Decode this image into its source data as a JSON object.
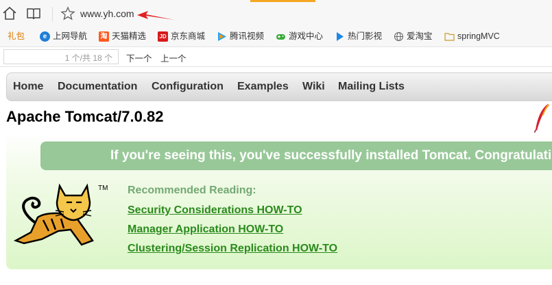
{
  "browser": {
    "url": "www.yh.com",
    "icons": [
      "home-icon",
      "reader-icon",
      "star-icon"
    ],
    "accent_color": "#f5a623"
  },
  "bookmarks": [
    {
      "label": "礼包",
      "icon": ""
    },
    {
      "label": "上网导航",
      "icon": "e"
    },
    {
      "label": "天猫精选",
      "icon": "淘"
    },
    {
      "label": "京东商城",
      "icon": "JD"
    },
    {
      "label": "腾讯视频",
      "icon": "▶"
    },
    {
      "label": "游戏中心",
      "icon": "gamepad"
    },
    {
      "label": "热门影视",
      "icon": "play"
    },
    {
      "label": "爱淘宝",
      "icon": "globe"
    },
    {
      "label": "springMVC",
      "icon": "folder"
    }
  ],
  "findbar": {
    "count": "1 个/共 18 个",
    "next": "下一个",
    "prev": "上一个"
  },
  "nav": [
    "Home",
    "Documentation",
    "Configuration",
    "Examples",
    "Wiki",
    "Mailing Lists"
  ],
  "page": {
    "title": "Apache Tomcat/7.0.82",
    "banner": "If you're seeing this, you've successfully installed Tomcat. Congratulations!",
    "trademark": "TM",
    "recommended_title": "Recommended Reading:",
    "links": [
      "Security Considerations HOW-TO",
      "Manager Application HOW-TO",
      "Clustering/Session Replication HOW-TO"
    ]
  },
  "colors": {
    "banner_bg": "#98c898",
    "link": "#2a8a1c",
    "recommended": "#74a874"
  }
}
